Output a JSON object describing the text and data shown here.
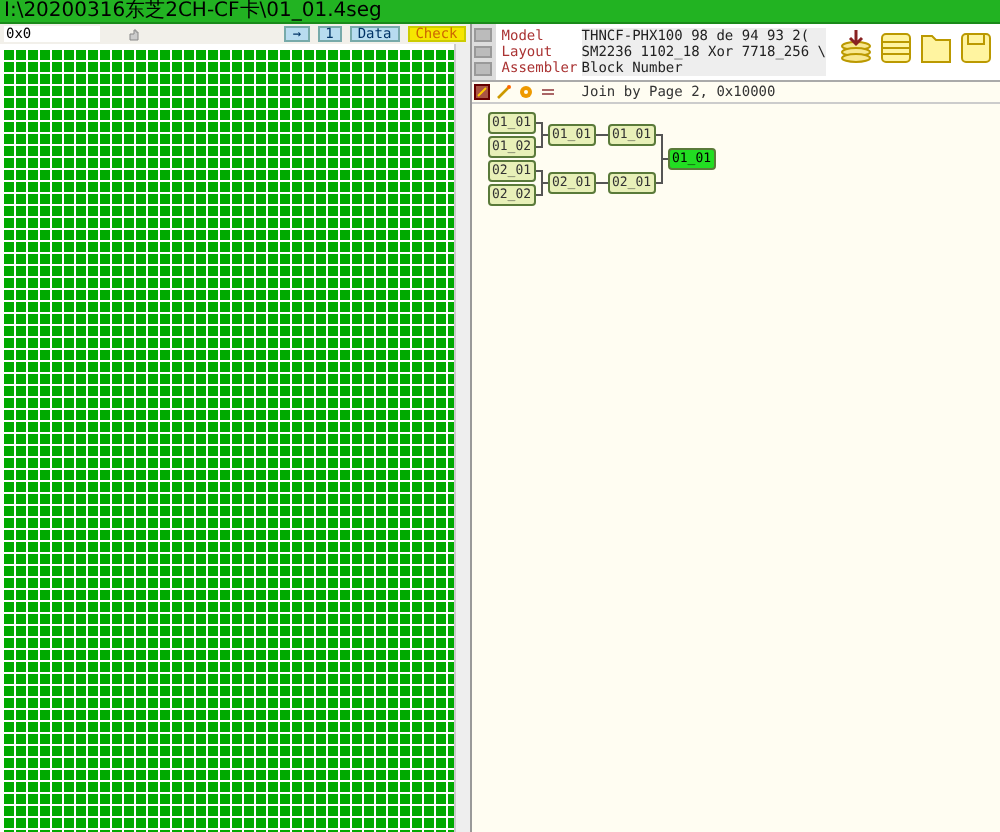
{
  "window": {
    "title": "I:\\20200316东芝2CH-CF卡\\01_01.4seg"
  },
  "toolbar": {
    "address": {
      "value": "0x0"
    },
    "buttons": [
      {
        "kind": "arrow",
        "label": "→"
      },
      {
        "kind": "plain",
        "label": "1"
      },
      {
        "kind": "plain",
        "label": "Data"
      },
      {
        "kind": "warn",
        "label": "Check"
      }
    ]
  },
  "info": [
    {
      "label": "Model",
      "value": "THNCF-PHX100  98 de 94 93  2("
    },
    {
      "label": "Layout",
      "value": "SM2236 1102_18 Xor 7718_256 \\"
    },
    {
      "label": "Assembler",
      "value": "Block Number"
    }
  ],
  "join": {
    "text": "Join by Page 2, 0x10000"
  },
  "tree": {
    "label": "01_01",
    "selected": true,
    "children": [
      {
        "label": "01_01",
        "selected": false,
        "children": [
          {
            "label": "01_01",
            "selected": false,
            "children": [
              {
                "label": "01_01",
                "selected": false
              },
              {
                "label": "01_02",
                "selected": false
              }
            ]
          }
        ]
      },
      {
        "label": "02_01",
        "selected": false,
        "children": [
          {
            "label": "02_01",
            "selected": false,
            "children": [
              {
                "label": "02_01",
                "selected": false
              },
              {
                "label": "02_02",
                "selected": false
              }
            ]
          }
        ]
      }
    ]
  }
}
